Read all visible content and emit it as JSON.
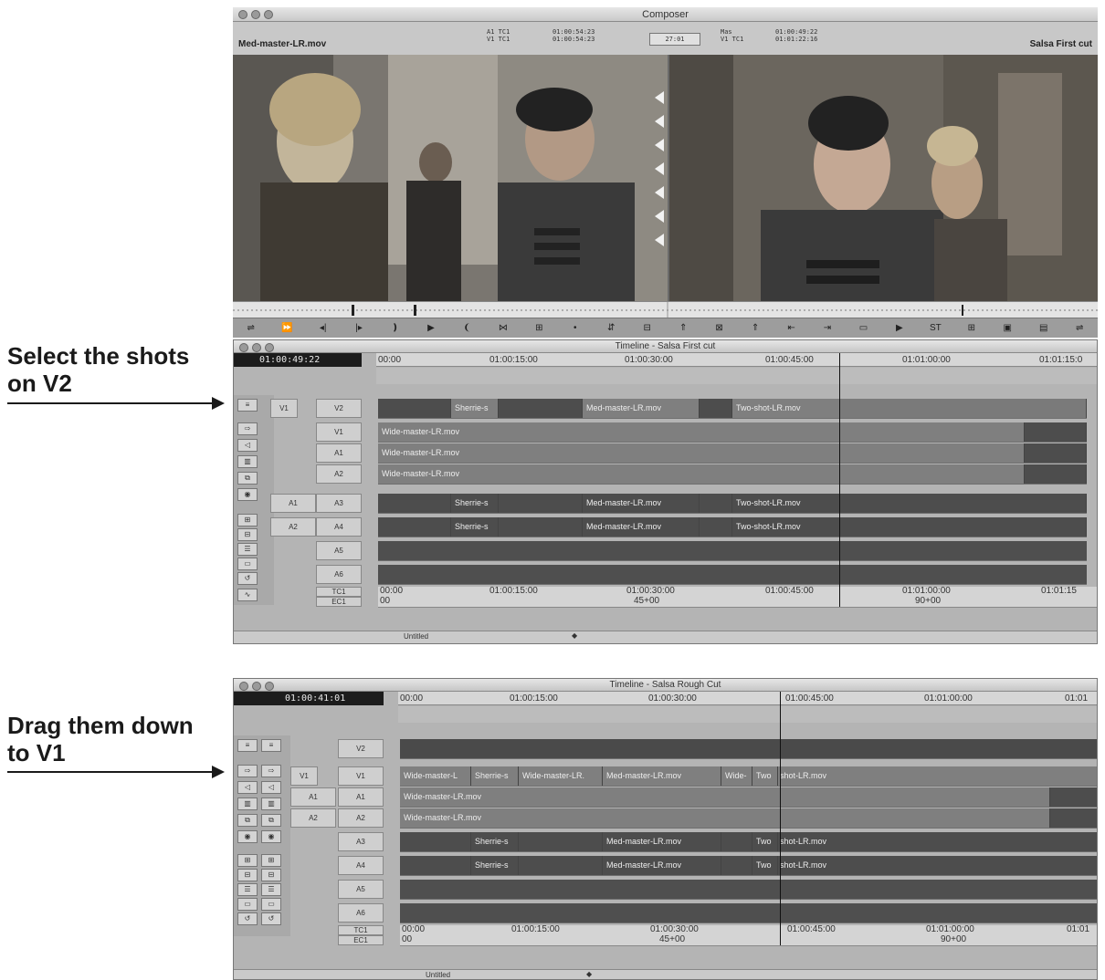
{
  "callouts": {
    "top_line1": "Select the shots",
    "top_line2": "on V2",
    "bottom_line1": "Drag them down",
    "bottom_line2": "to V1"
  },
  "composer": {
    "title": "Composer",
    "left_clip": "Med-master-LR.mov",
    "right_clip": "Salsa First cut",
    "a1_label": "A1 TC1",
    "a1_tc": "01:00:54:23",
    "v1_label": "V1 TC1",
    "v1_tc": "01:00:54:23",
    "center_tc": "27:01",
    "mas_label": "Mas",
    "mas_tc": "01:00:49:22",
    "r_v1_label": "V1 TC1",
    "r_v1_tc": "01:01:22:16"
  },
  "timeline1": {
    "title": "Timeline - Salsa First cut",
    "timecode": "01:00:49:22",
    "ruler": [
      "00:00",
      "01:00:15:00",
      "01:00:30:00",
      "01:00:45:00",
      "01:01:00:00",
      "01:01:15:0"
    ],
    "tracks": {
      "v2": "V2",
      "v1": "V1",
      "a1": "A1",
      "a2": "A2",
      "a3": "A3",
      "a4": "A4",
      "a5": "A5",
      "a6": "A6",
      "tc1": "TC1",
      "ec1": "EC1"
    },
    "clips": {
      "sherrie": "Sherrie-s",
      "med": "Med-master-LR.mov",
      "two": "Two-shot-LR.mov",
      "wide": "Wide-master-LR.mov"
    },
    "tc_row": [
      "00:00",
      "01:00:15:00",
      "01:00:30:00",
      "01:00:45:00",
      "01:01:00:00",
      "01:01:15"
    ],
    "ec_row": [
      "00",
      "45+00",
      "90+00"
    ],
    "bottom_label": "Untitled"
  },
  "timeline2": {
    "title": "Timeline - Salsa Rough Cut",
    "timecode": "01:00:41:01",
    "ruler": [
      "00:00",
      "01:00:15:00",
      "01:00:30:00",
      "01:00:45:00",
      "01:01:00:00",
      "01:01"
    ],
    "clips": {
      "wide_short": "Wide-master-L",
      "sherrie": "Sherrie-s",
      "wide_lr": "Wide-master-LR.",
      "med": "Med-master-LR.mov",
      "wide_tiny": "Wide-",
      "two_a": "Two",
      "two_b": "shot-LR.mov",
      "wide": "Wide-master-LR.mov"
    },
    "tc_row": [
      "00:00",
      "01:00:15:00",
      "01:00:30:00",
      "01:00:45:00",
      "01:01:00:00",
      "01:01"
    ],
    "ec_row": [
      "00",
      "45+00",
      "90+00"
    ],
    "bottom_label": "Untitled"
  }
}
